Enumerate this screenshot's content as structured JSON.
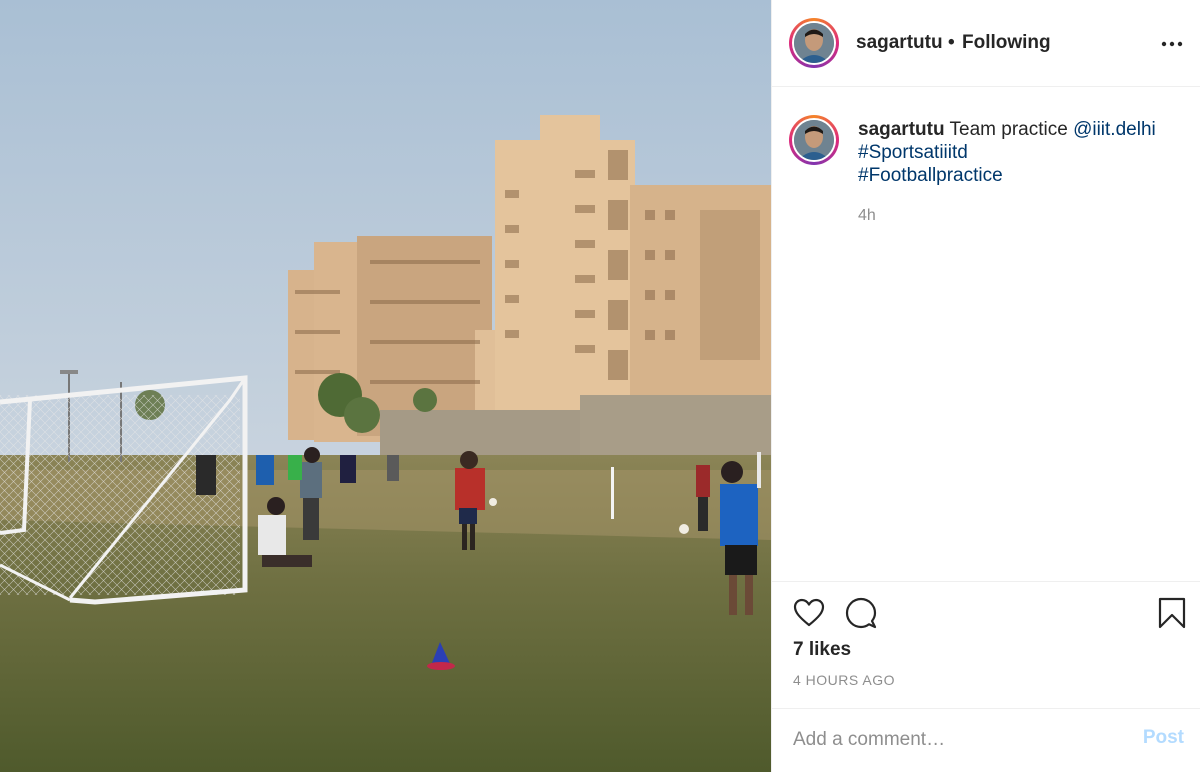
{
  "post": {
    "image_alt": "Football practice on a field in front of campus buildings"
  },
  "header": {
    "username": "sagartutu",
    "separator": "•",
    "follow_status": "Following",
    "more_icon": "more-horizontal-icon"
  },
  "caption": {
    "username": "sagartutu",
    "text": "Team practice",
    "mention": "@iiit.delhi",
    "hashtags": [
      "#Sportsatiiitd",
      "#Footballpractice"
    ],
    "time": "4h"
  },
  "actions": {
    "like_icon": "heart-icon",
    "comment_icon": "comment-icon",
    "save_icon": "bookmark-icon",
    "likes": "7 likes",
    "time_ago": "4 HOURS AGO"
  },
  "comment": {
    "placeholder": "Add a comment…",
    "post_label": "Post"
  },
  "colors": {
    "link": "#00376b",
    "post_disabled": "#b3dbff",
    "muted": "#8e8e8e"
  }
}
